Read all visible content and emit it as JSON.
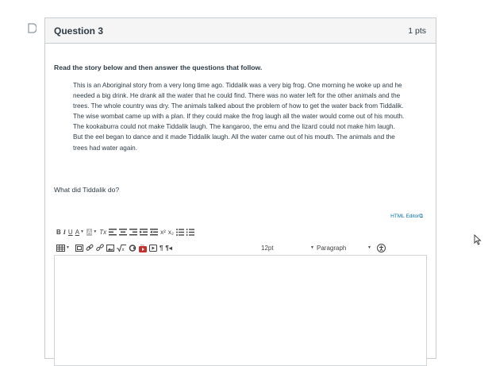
{
  "question": {
    "title": "Question 3",
    "points": "1 pts",
    "instructions": "Read the story below and then answer the questions that follow.",
    "story": "This is an Aboriginal story from a very long time ago. Tiddalik was a very big frog. One morning he woke up and he needed a big drink. He drank all the water that he could find. There was no water left for the other animals and the trees. The whole country was dry. The animals talked about the problem of how to get the water back from Tiddalik. The wise wombat came up with a plan. If they could make the frog laugh all the water would come out of his mouth. The kookaburra could not make Tiddalik laugh. The kangaroo, the emu and the lizard could not make him laugh. But the eel began to dance and it made Tiddalik laugh. All the water came out of his mouth. The animals and the trees had water again.",
    "prompt": "What did Tiddalik do?"
  },
  "editor": {
    "html_editor_link": "HTML Editor",
    "toolbar": {
      "bold": "B",
      "italic": "I",
      "underline": "U",
      "font_color": "A",
      "background_color": "A",
      "clear_formatting": "Tx",
      "superscript": "x²",
      "subscript": "x₂",
      "font_size": "12pt",
      "paragraph": "Paragraph"
    },
    "content": ""
  },
  "icons": [
    "flag-icon",
    "table-icon",
    "media-icon",
    "link-icon",
    "unlink-icon",
    "image-icon",
    "equation-icon",
    "embed-icon",
    "youtube-icon",
    "record-icon",
    "ltr-icon",
    "rtl-icon",
    "accessibility-icon",
    "pointer-cursor-icon"
  ],
  "colors": {
    "link": "#0770a3",
    "header_bg": "#f5f5f5",
    "border": "#c7cdd1",
    "text": "#2d3b45"
  }
}
